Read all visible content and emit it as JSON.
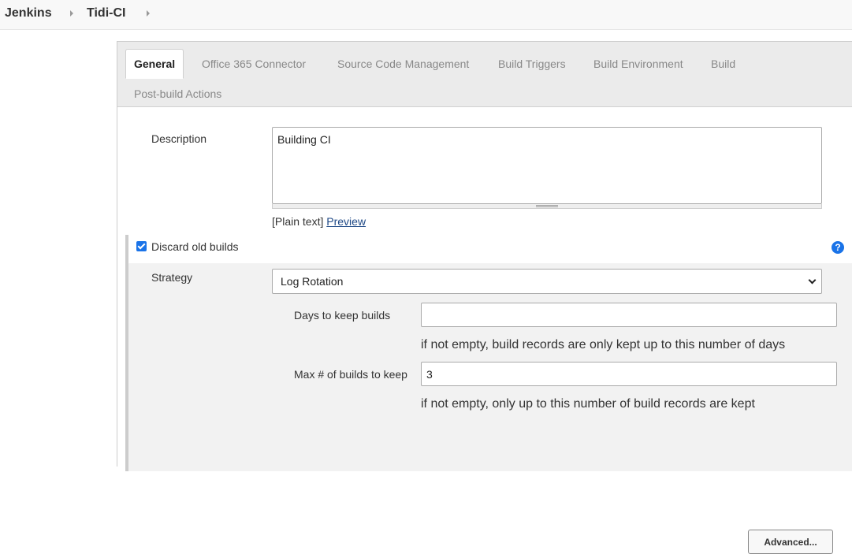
{
  "breadcrumb": {
    "items": [
      "Jenkins",
      "Tidi-CI"
    ]
  },
  "tabs": [
    {
      "label": "General",
      "active": true
    },
    {
      "label": "Office 365 Connector"
    },
    {
      "label": "Source Code Management"
    },
    {
      "label": "Build Triggers"
    },
    {
      "label": "Build Environment"
    },
    {
      "label": "Build"
    },
    {
      "label": "Post-build Actions"
    }
  ],
  "general": {
    "description_label": "Description",
    "description_value": "Building CI",
    "plain_text": "[Plain text]",
    "preview_link": "Preview",
    "discard_label": "Discard old builds",
    "discard_checked": true,
    "help_icon": "?",
    "strategy_label": "Strategy",
    "strategy_value": "Log Rotation",
    "days_label": "Days to keep builds",
    "days_value": "",
    "days_hint": "if not empty, build records are only kept up to this number of days",
    "max_label": "Max # of builds to keep",
    "max_value": "3",
    "max_hint": "if not empty, only up to this number of build records are kept",
    "advanced_button": "Advanced..."
  },
  "colors": {
    "accent": "#1a73e8",
    "link": "#204a87"
  }
}
